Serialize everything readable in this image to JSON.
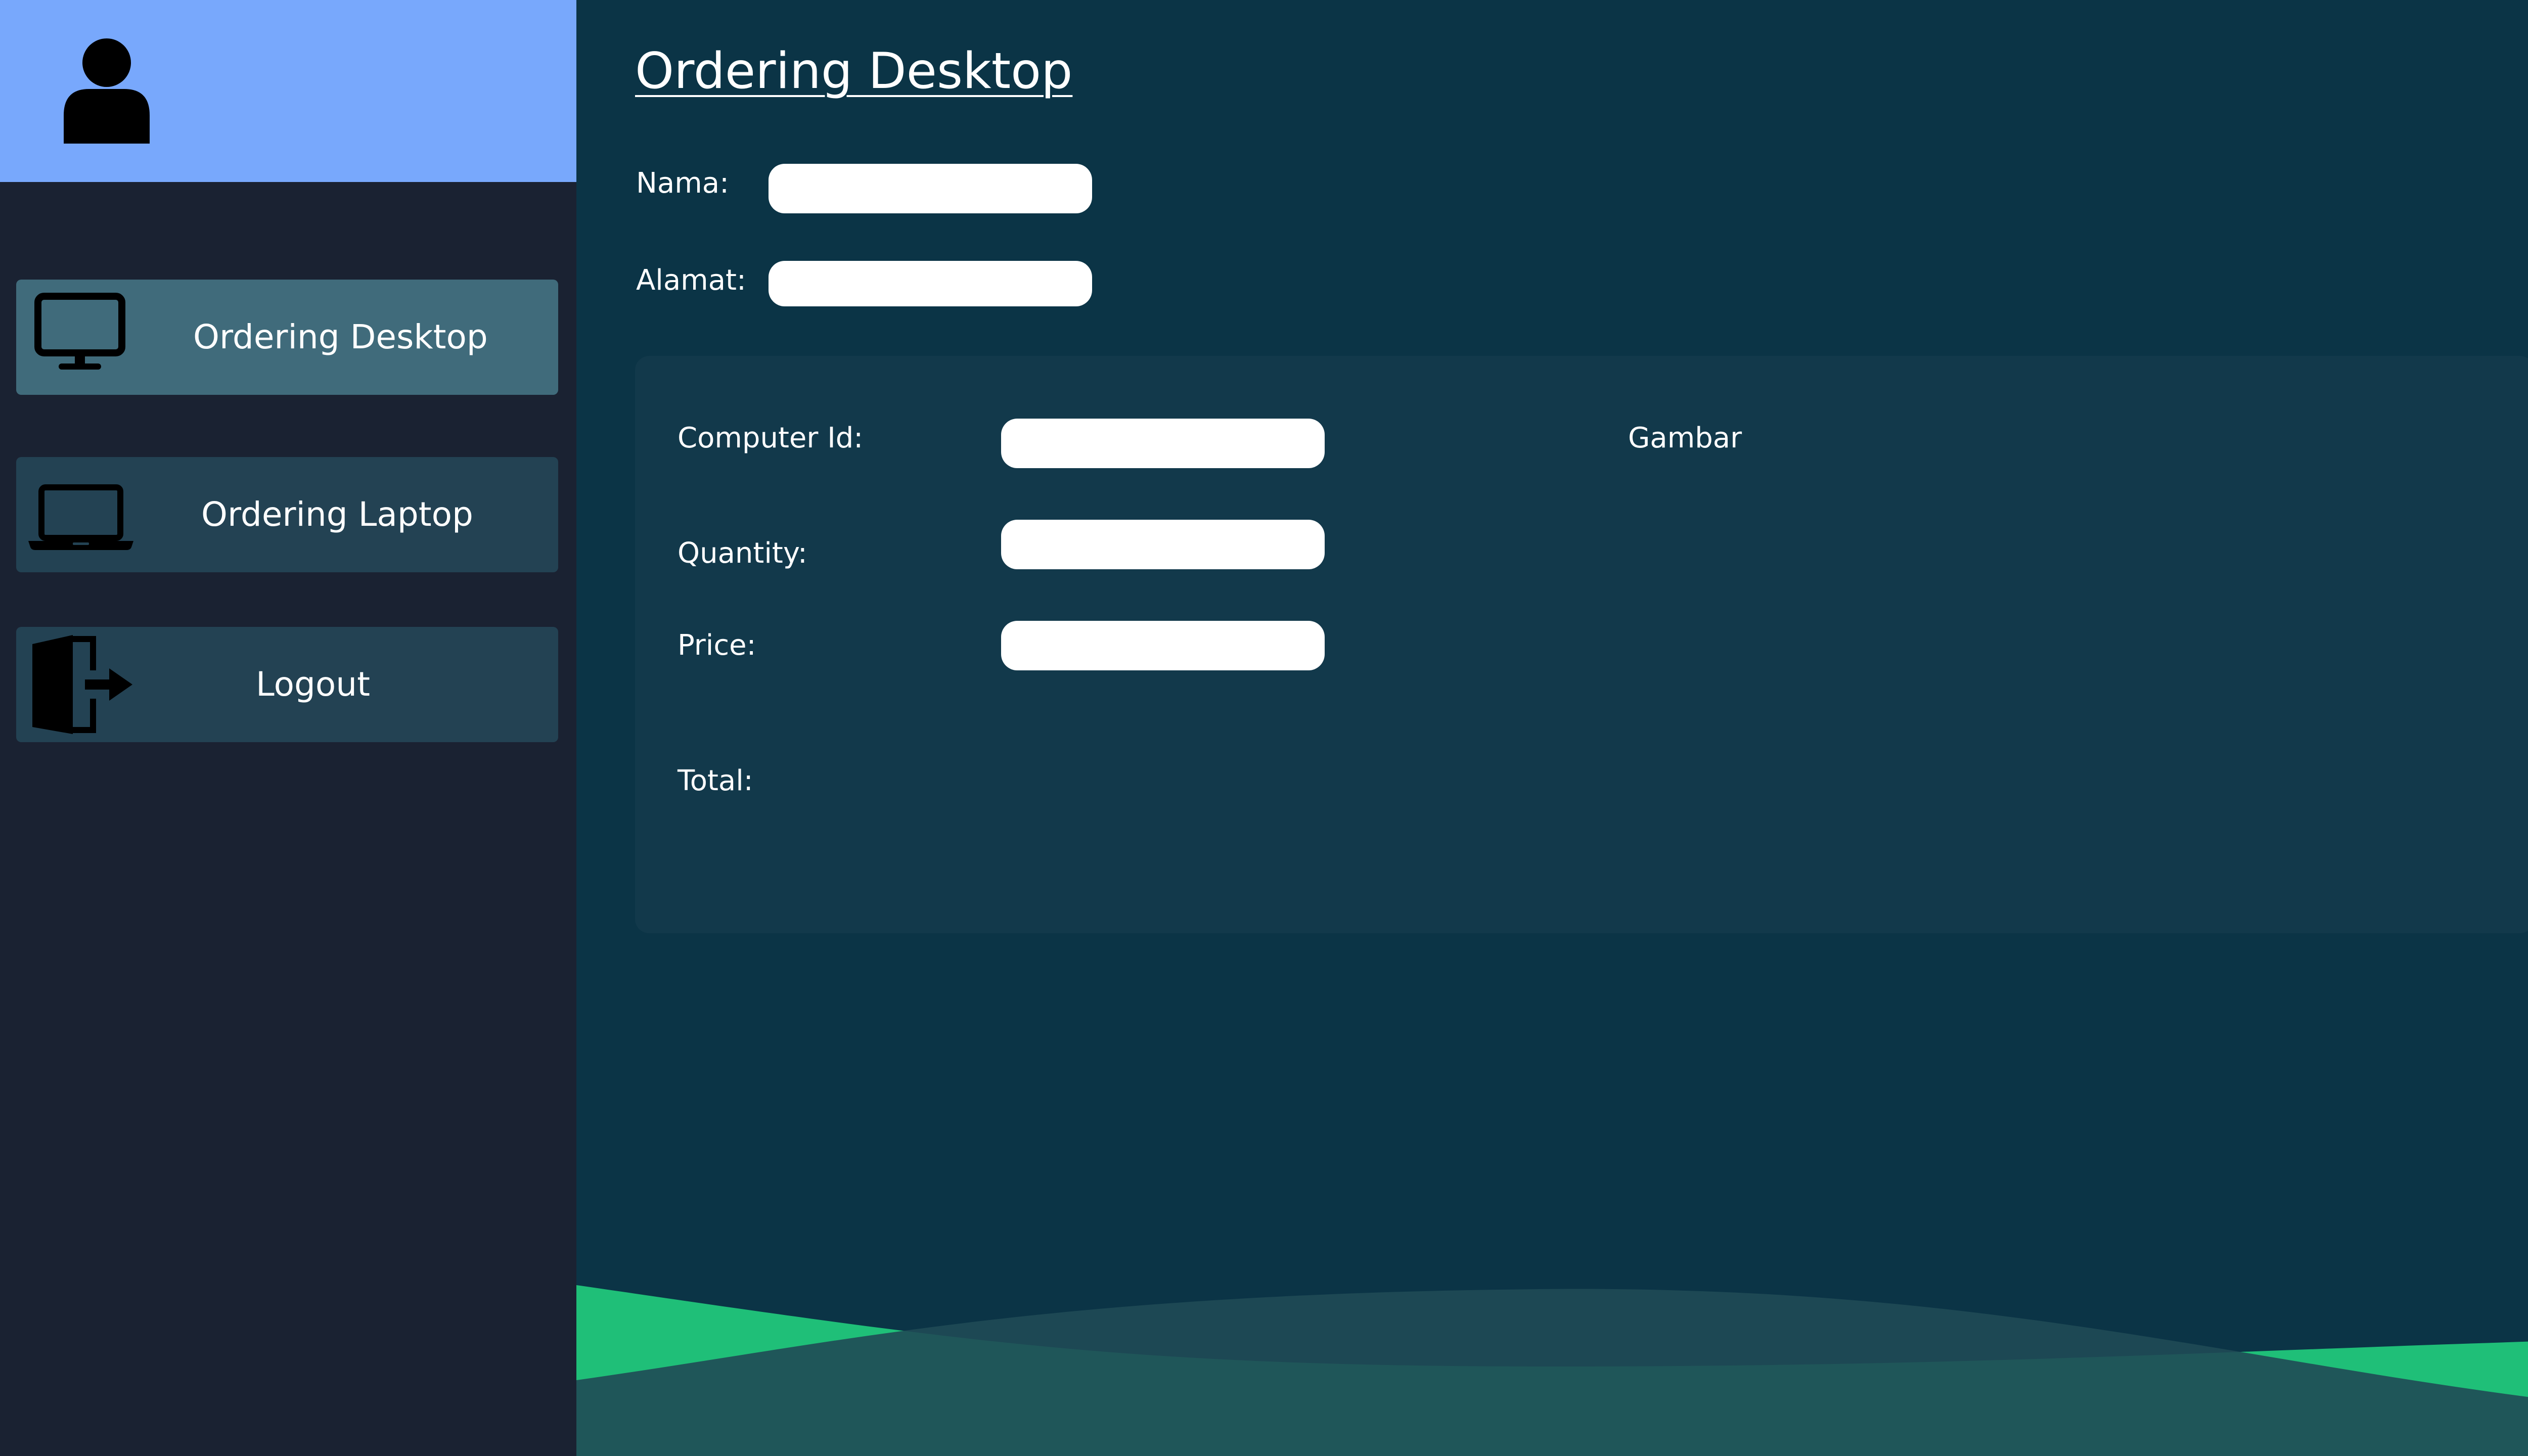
{
  "sidebar": {
    "profile": {
      "icon": "user-icon"
    },
    "items": [
      {
        "label": "Ordering Desktop",
        "icon": "desktop-monitor-icon",
        "active": true
      },
      {
        "label": "Ordering Laptop",
        "icon": "laptop-icon",
        "active": false
      },
      {
        "label": "Logout",
        "icon": "logout-door-icon",
        "active": false
      }
    ]
  },
  "main": {
    "title": "Ordering Desktop",
    "customer": {
      "nama_label": "Nama:",
      "nama_value": "",
      "alamat_label": "Alamat:",
      "alamat_value": ""
    },
    "order": {
      "computer_id_label": "Computer Id:",
      "computer_id_value": "",
      "quantity_label": "Quantity:",
      "quantity_value": "",
      "price_label": "Price:",
      "price_value": "",
      "total_label": "Total:",
      "gambar_label": "Gambar"
    }
  },
  "colors": {
    "sidebar_bg": "#1a2232",
    "profile_bg": "#78a8fc",
    "nav_active_bg": "#406b7b",
    "nav_bg": "#234253",
    "main_bg": "#0b3446",
    "panel_bg": "#12394b",
    "wave_green": "#1fbf78",
    "wave_teal": "#236060"
  }
}
